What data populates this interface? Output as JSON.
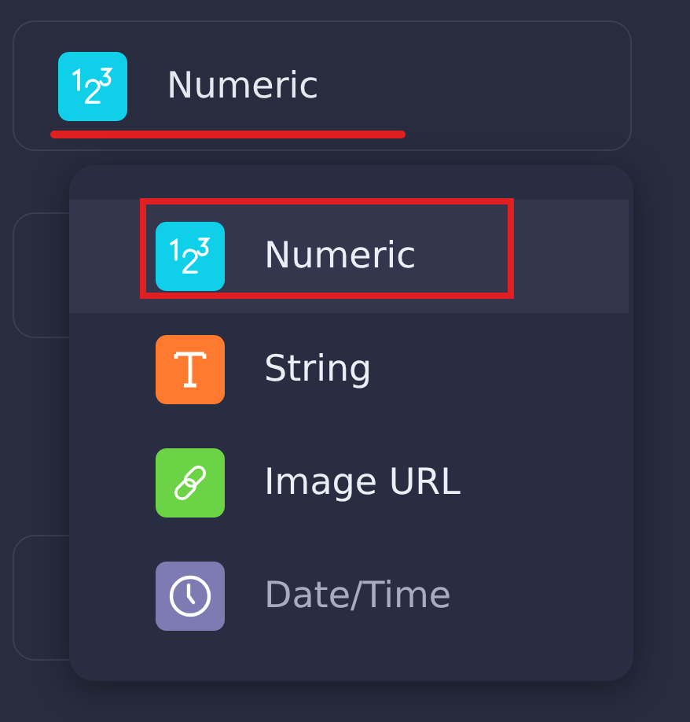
{
  "field": {
    "value": "Numeric",
    "kind": "numeric",
    "color": "#0fd0e8"
  },
  "menu": {
    "items": [
      {
        "label": "Numeric",
        "kind": "numeric",
        "color": "#0fd0e8",
        "selected": true,
        "disabled": false
      },
      {
        "label": "String",
        "kind": "string",
        "color": "#fd7a2e",
        "selected": false,
        "disabled": false
      },
      {
        "label": "Image URL",
        "kind": "link",
        "color": "#6cd347",
        "selected": false,
        "disabled": false
      },
      {
        "label": "Date/Time",
        "kind": "time",
        "color": "#7e7bb3",
        "selected": false,
        "disabled": true
      }
    ]
  }
}
